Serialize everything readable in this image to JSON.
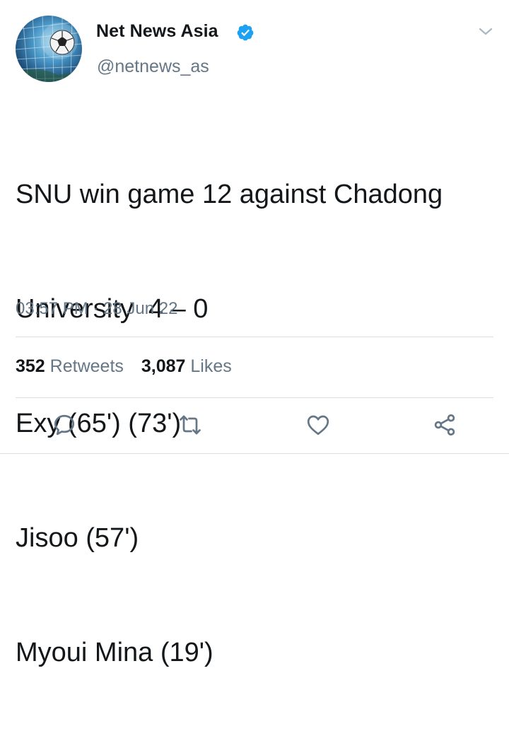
{
  "tweet": {
    "display_name": "Net News Asia",
    "handle": "@netnews_as",
    "text_lines": [
      "SNU win game 12 against Chadong",
      "University  4 – 0",
      "Exy (65') (73')",
      "Jisoo (57')",
      "Myoui Mina (19')"
    ],
    "timestamp": "03:57 PM · 28 Jun 22",
    "retweets_count": "352",
    "retweets_label": "Retweets",
    "likes_count": "3,087",
    "likes_label": "Likes"
  },
  "colors": {
    "accent": "#1da1f2",
    "text_primary": "#14171a",
    "text_secondary": "#657786",
    "divider": "#d8dee3"
  },
  "icons": {
    "avatar": "soccer-ball-in-net",
    "verified": "verified-badge-icon",
    "menu": "chevron-down-icon",
    "reply": "reply-icon",
    "retweet": "retweet-icon",
    "like": "heart-icon",
    "share": "share-icon"
  }
}
